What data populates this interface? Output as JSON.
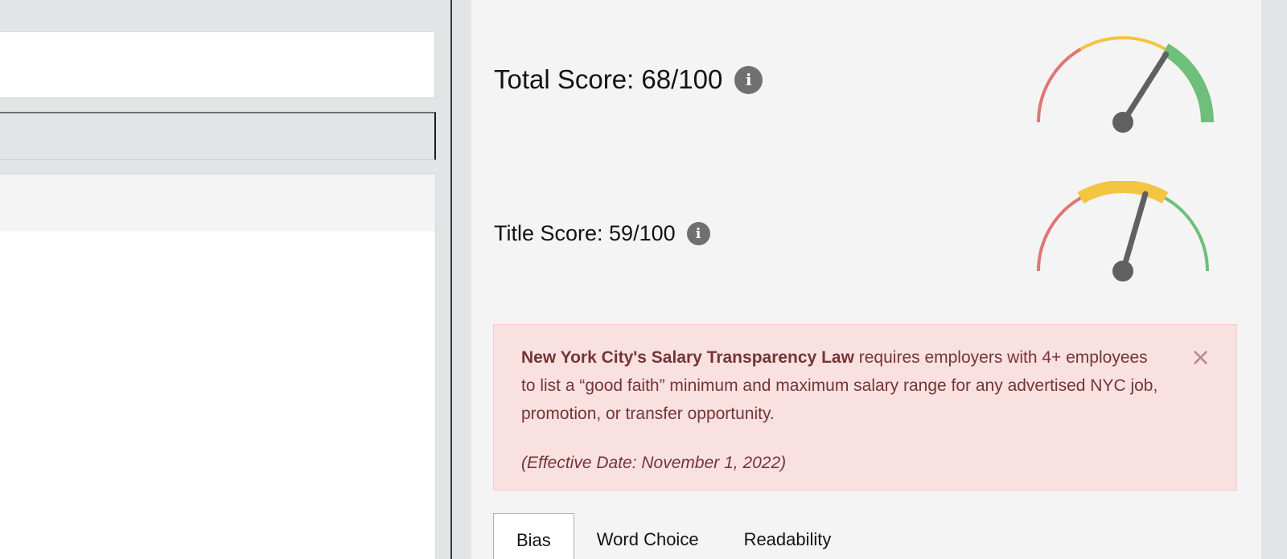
{
  "scores": {
    "total": {
      "label": "Total Score: 68/100",
      "value": 68,
      "max": 100,
      "info_icon": "info-icon"
    },
    "title": {
      "label": "Title Score: 59/100",
      "value": 59,
      "max": 100,
      "info_icon": "info-icon"
    }
  },
  "colors": {
    "red": "#e07672",
    "yellow": "#f4c443",
    "green": "#6dbf7a",
    "needle": "#606060"
  },
  "alert": {
    "law_name": "New York City's Salary Transparency Law",
    "text": " requires employers with 4+ employees to list a “good faith” minimum and maximum salary range for any advertised NYC job, promotion, or transfer opportunity.",
    "effective_date": "(Effective Date: November 1, 2022)",
    "close_symbol": "×"
  },
  "tabs": [
    {
      "label": "Bias",
      "active": true
    },
    {
      "label": "Word Choice",
      "active": false
    },
    {
      "label": "Readability",
      "active": false
    }
  ]
}
